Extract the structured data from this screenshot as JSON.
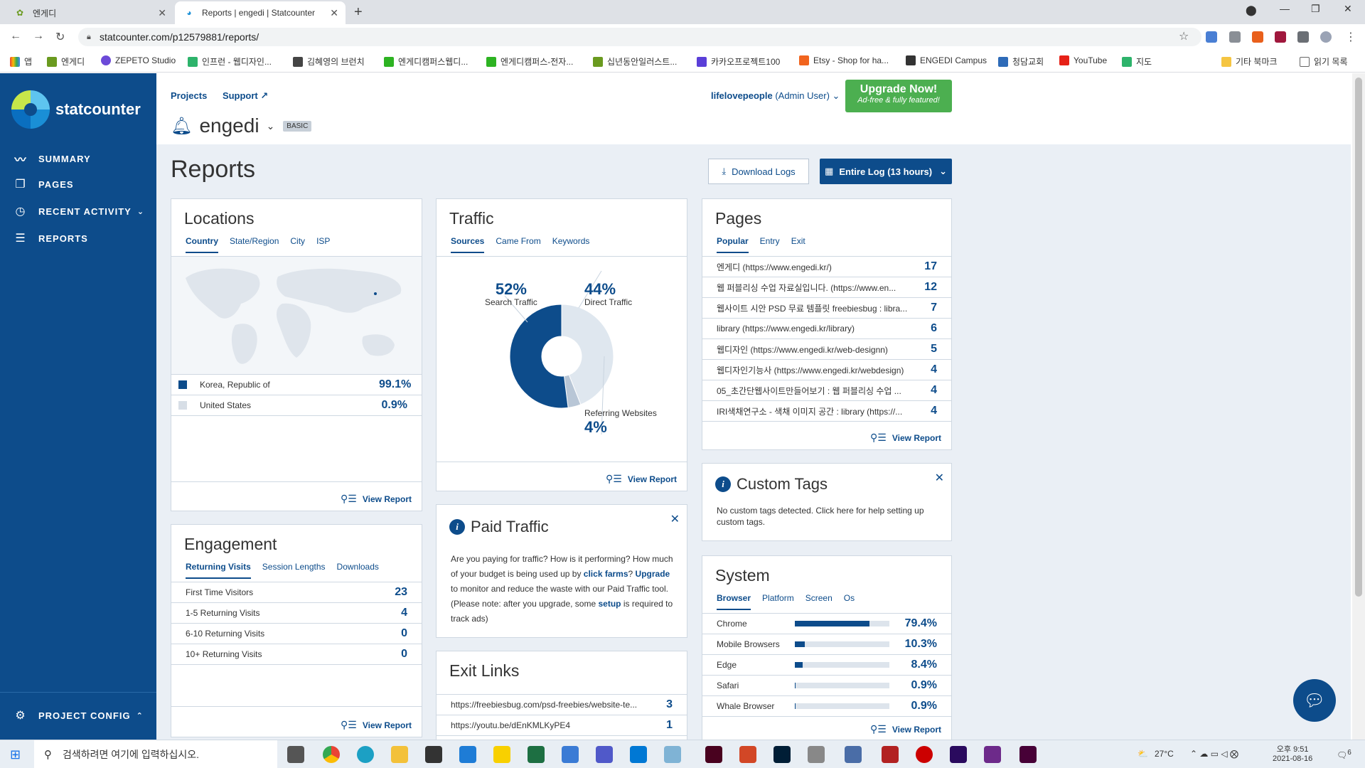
{
  "browser": {
    "tabs": [
      {
        "title": "엔게디",
        "active": false
      },
      {
        "title": "Reports | engedi | Statcounter",
        "active": true
      }
    ],
    "url": "statcounter.com/p12579881/reports/",
    "bookmarks": [
      "앱",
      "엔게디",
      "ZEPETO Studio",
      "인프런 - 웹디자인...",
      "김혜영의 브런치",
      "엔게디캠퍼스웹디...",
      "엔게디캠퍼스-전자...",
      "십년동안일러스트...",
      "카카오프로젝트100",
      "Etsy - Shop for ha...",
      "ENGEDI Campus",
      "청담교회",
      "YouTube",
      "지도",
      "기타 북마크",
      "읽기 목록"
    ]
  },
  "sidebar": {
    "brand": "statcounter",
    "items": [
      {
        "label": "SUMMARY",
        "icon": "graph-icon"
      },
      {
        "label": "PAGES",
        "icon": "pages-icon"
      },
      {
        "label": "RECENT ACTIVITY",
        "icon": "clock-icon"
      },
      {
        "label": "REPORTS",
        "icon": "list-icon"
      }
    ],
    "config_label": "PROJECT CONFIG"
  },
  "header": {
    "projects": "Projects",
    "support": "Support",
    "project_name": "engedi",
    "plan_badge": "BASIC",
    "user": "lifelovepeople",
    "user_role": "(Admin User)",
    "upgrade_title": "Upgrade Now!",
    "upgrade_sub": "Ad-free & fully featured!"
  },
  "page": {
    "title": "Reports",
    "download_logs": "Download Logs",
    "range": "Entire Log (13 hours)"
  },
  "view_report": "View Report",
  "locations": {
    "title": "Locations",
    "tabs": [
      "Country",
      "State/Region",
      "City",
      "ISP"
    ],
    "rows": [
      {
        "label": "Korea, Republic of",
        "value": "99.1%"
      },
      {
        "label": "United States",
        "value": "0.9%"
      }
    ]
  },
  "traffic": {
    "title": "Traffic",
    "tabs": [
      "Sources",
      "Came From",
      "Keywords"
    ],
    "segments": [
      {
        "label": "Search Traffic",
        "value": "52%",
        "pct": 52,
        "color": "#0d4c8b"
      },
      {
        "label": "Direct Traffic",
        "value": "44%",
        "pct": 44,
        "color": "#dfe7ef"
      },
      {
        "label": "Referring Websites",
        "value": "4%",
        "pct": 4,
        "color": "#b8c6d6"
      }
    ]
  },
  "pages_card": {
    "title": "Pages",
    "tabs": [
      "Popular",
      "Entry",
      "Exit"
    ],
    "rows": [
      {
        "label": "엔게디 (https://www.engedi.kr/)",
        "value": "17"
      },
      {
        "label": "웹 퍼블리싱 수업 자료실입니다. (https://www.en...",
        "value": "12"
      },
      {
        "label": "웹사이트 시안 PSD 무료 템플릿 freebiesbug : libra...",
        "value": "7"
      },
      {
        "label": "library (https://www.engedi.kr/library)",
        "value": "6"
      },
      {
        "label": "웹디자인 (https://www.engedi.kr/web-designn)",
        "value": "5"
      },
      {
        "label": "웹디자인기능사 (https://www.engedi.kr/webdesign)",
        "value": "4"
      },
      {
        "label": "05_초간단웹사이트만들어보기 : 웹 퍼블리싱 수업 ...",
        "value": "4"
      },
      {
        "label": "IRI색채연구소 - 색채 이미지 공간 : library (https://...",
        "value": "4"
      }
    ]
  },
  "custom_tags": {
    "title": "Custom Tags",
    "text": "No custom tags detected. Click here for help setting up custom tags."
  },
  "paid_traffic": {
    "title": "Paid Traffic",
    "p1": "Are you paying for traffic? How is it performing? How much of your budget is being used up by ",
    "link1": "click farms",
    "p2": "? ",
    "link2": "Upgrade",
    "p3": " to monitor and reduce the waste with our Paid Traffic tool. (Please note: after you upgrade, some ",
    "link3": "setup",
    "p4": " is required to track ads)"
  },
  "engagement": {
    "title": "Engagement",
    "tabs": [
      "Returning Visits",
      "Session Lengths",
      "Downloads"
    ],
    "rows": [
      {
        "label": "First Time Visitors",
        "value": "23"
      },
      {
        "label": "1-5 Returning Visits",
        "value": "4"
      },
      {
        "label": "6-10 Returning Visits",
        "value": "0"
      },
      {
        "label": "10+ Returning Visits",
        "value": "0"
      }
    ]
  },
  "exit_links": {
    "title": "Exit Links",
    "rows": [
      {
        "label": "https://freebiesbug.com/psd-freebies/website-te...",
        "value": "3"
      },
      {
        "label": "https://youtu.be/dEnKMLKyPE4",
        "value": "1"
      }
    ]
  },
  "system": {
    "title": "System",
    "tabs": [
      "Browser",
      "Platform",
      "Screen",
      "Os"
    ],
    "rows": [
      {
        "label": "Chrome",
        "value": "79.4%",
        "pct": 79.4
      },
      {
        "label": "Mobile Browsers",
        "value": "10.3%",
        "pct": 10.3
      },
      {
        "label": "Edge",
        "value": "8.4%",
        "pct": 8.4
      },
      {
        "label": "Safari",
        "value": "0.9%",
        "pct": 0.9
      },
      {
        "label": "Whale Browser",
        "value": "0.9%",
        "pct": 0.9
      }
    ]
  },
  "taskbar": {
    "search_placeholder": "검색하려면 여기에 입력하십시오.",
    "temperature": "27°C",
    "ampm_time": "오후 9:51",
    "date": "2021-08-16",
    "notif_count": "6"
  },
  "colors": {
    "primary": "#0d4c8b",
    "upgrade": "#4caf50",
    "bg": "#eaeff5"
  }
}
